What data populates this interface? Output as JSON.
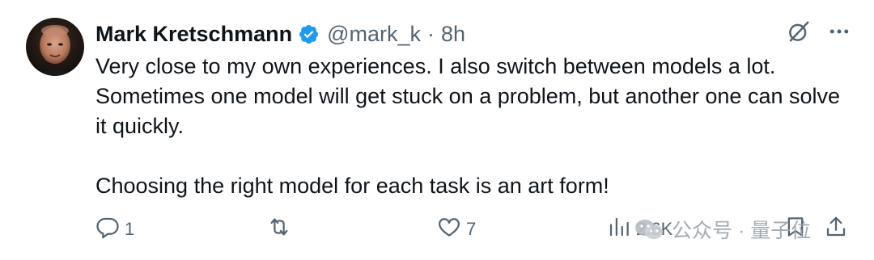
{
  "tweet": {
    "author_name": "Mark Kretschmann",
    "handle": "@mark_k",
    "separator": "·",
    "time": "8h",
    "paragraphs": [
      "Very close to my own experiences. I also switch between models a lot. Sometimes one model will get stuck on a problem, but another one can solve it quickly.",
      "Choosing the right model for each task is an art form!"
    ]
  },
  "actions": {
    "reply_count": "1",
    "repost_count": "",
    "like_count": "7",
    "views_count": "2.6K"
  },
  "watermark": {
    "text": "公众号 · 量子位"
  },
  "icons": {
    "verified": "verified-badge-icon",
    "grok": "grok-icon",
    "more": "more-dots-icon",
    "reply": "reply-icon",
    "repost": "repost-icon",
    "like": "heart-icon",
    "views": "views-chart-icon",
    "bookmark": "bookmark-icon",
    "share": "share-icon"
  },
  "colors": {
    "verified_blue": "#1d9bf0",
    "text_primary": "#0f1419",
    "text_secondary": "#536471"
  }
}
